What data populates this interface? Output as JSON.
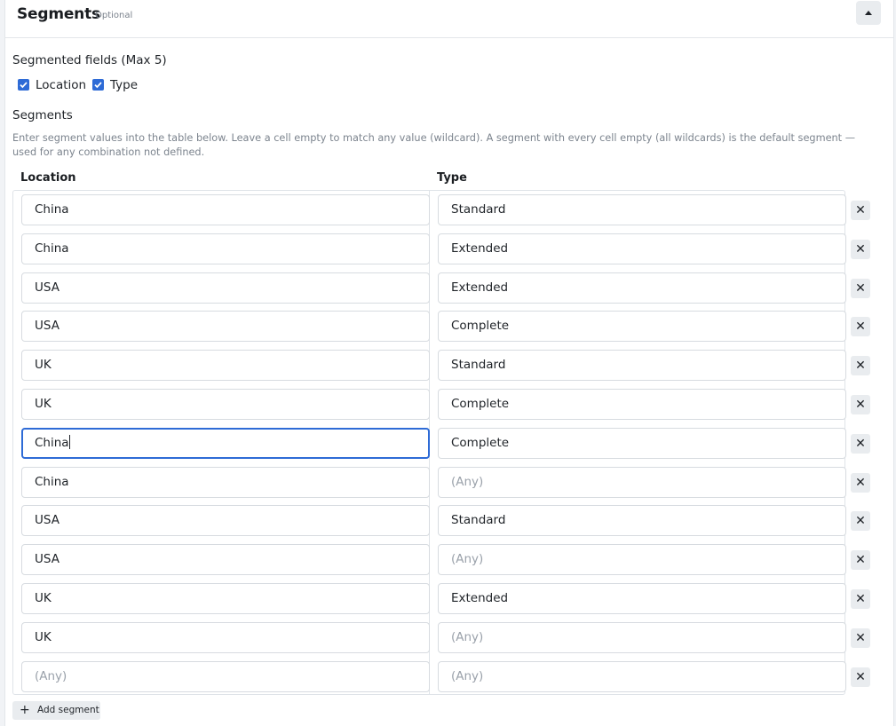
{
  "panel": {
    "title": "Segments",
    "optional": "Optional",
    "collapse_icon": "caret-up-icon"
  },
  "segmented_fields": {
    "label": "Segmented fields (Max 5)",
    "options": [
      {
        "label": "Location",
        "checked": true
      },
      {
        "label": "Type",
        "checked": true
      }
    ]
  },
  "segments": {
    "label": "Segments",
    "help": "Enter segment values into the table below. Leave a cell empty to match any value (wildcard). A segment with every cell empty (all wildcards) is the default segment — used for any combination not defined.",
    "columns": [
      "Location",
      "Type"
    ],
    "placeholder": "(Any)",
    "rows": [
      {
        "location": "China",
        "type": "Standard"
      },
      {
        "location": "China",
        "type": "Extended"
      },
      {
        "location": "USA",
        "type": "Extended"
      },
      {
        "location": "USA",
        "type": "Complete"
      },
      {
        "location": "UK",
        "type": "Standard"
      },
      {
        "location": "UK",
        "type": "Complete"
      },
      {
        "location": "China",
        "type": "Complete"
      },
      {
        "location": "China",
        "type": ""
      },
      {
        "location": "USA",
        "type": "Standard"
      },
      {
        "location": "USA",
        "type": ""
      },
      {
        "location": "UK",
        "type": "Extended"
      },
      {
        "location": "UK",
        "type": ""
      },
      {
        "location": "",
        "type": ""
      }
    ],
    "focused_row": 6,
    "delete_icon": "close-icon",
    "add_label": "Add segment",
    "add_icon": "plus-icon"
  },
  "colors": {
    "accent": "#2e6bd6",
    "button_bg": "#e9ecef",
    "placeholder": "#9aa1aa"
  }
}
